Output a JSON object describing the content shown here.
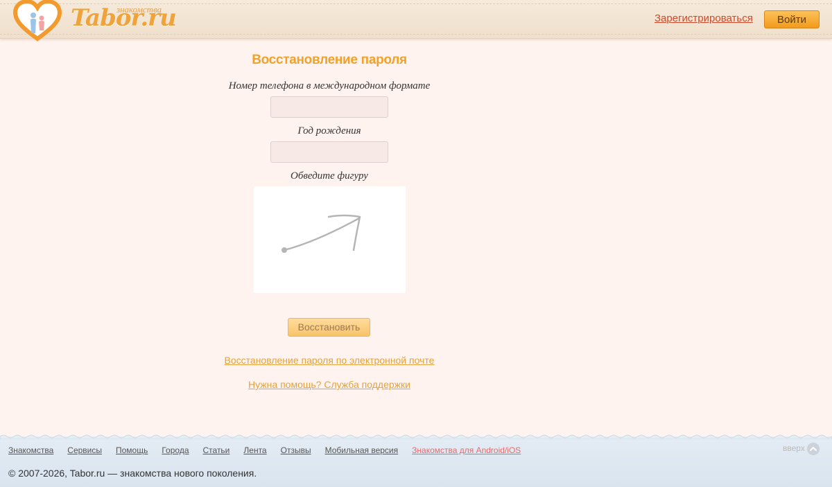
{
  "header": {
    "logo_text": "Tabor.ru",
    "logo_subtext": "знакомства",
    "register_label": "Зарегистрироваться",
    "login_label": "Войти"
  },
  "form": {
    "title": "Восстановление пароля",
    "phone_label": "Номер телефона в международном формате",
    "phone_value": "",
    "birth_year_label": "Год рождения",
    "birth_year_value": "",
    "captcha_label": "Обведите фигуру",
    "submit_label": "Восстановить"
  },
  "links": {
    "email_recovery": "Восстановление пароля по электронной почте",
    "support": "Нужна помощь? Служба поддержки"
  },
  "footer": {
    "nav": [
      "Знакомства",
      "Сервисы",
      "Помощь",
      "Города",
      "Статьи",
      "Лента",
      "Отзывы",
      "Мобильная версия",
      "Знакомства для Android/iOS"
    ],
    "to_top_label": "вверх",
    "copyright": "© 2007-2026, Tabor.ru — знакомства нового поколения."
  },
  "colors": {
    "accent": "#f0a22c",
    "register_link": "#d2492a",
    "background": "#fff3ef"
  }
}
